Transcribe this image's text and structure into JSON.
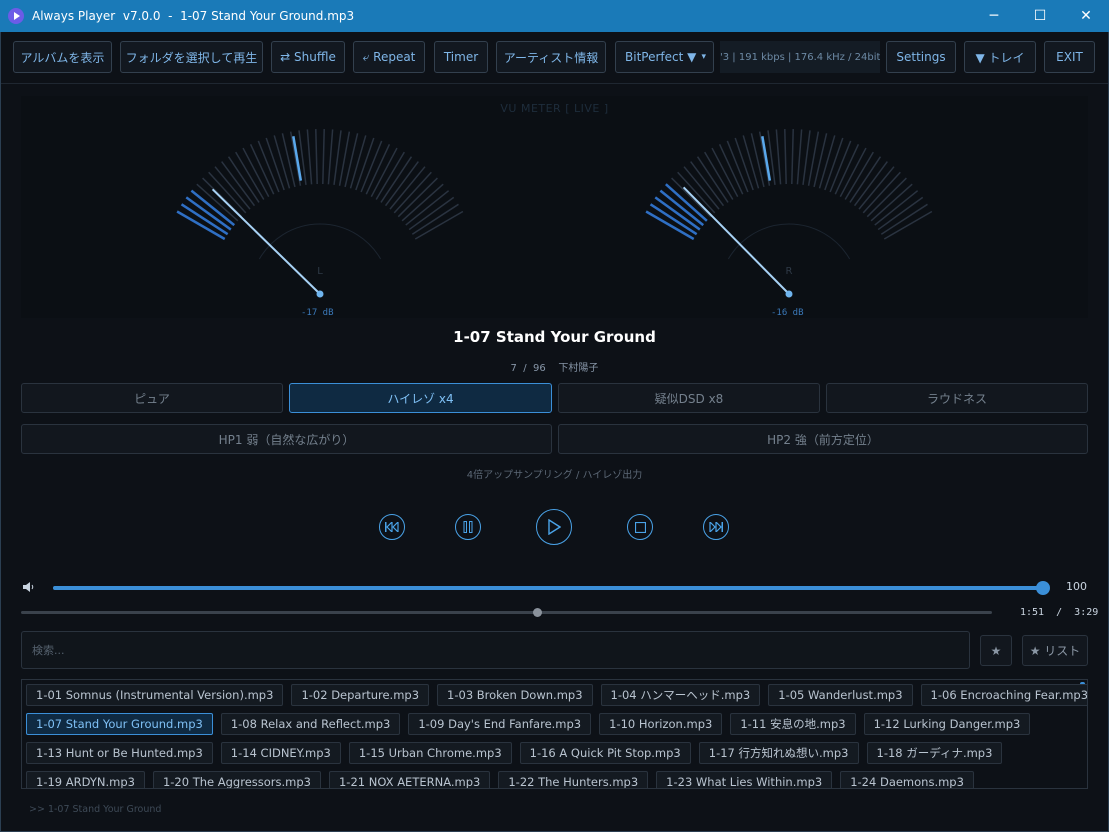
{
  "window": {
    "title": "Always Player  v7.0.0  -  1-07 Stand Your Ground.mp3",
    "minimize": "─",
    "maximize": "☐",
    "close": "✕"
  },
  "toolbar": {
    "album": "アルバムを表示",
    "folder_play": "フォルダを選択して再生",
    "shuffle": "⇄ Shuffle",
    "repeat": "⤶ Repeat",
    "timer": "Timer",
    "artist_info": "アーティスト情報",
    "bitperfect": "BitPerfect ▼",
    "bitperfect_arrow": "▾",
    "format_info": "'3 | 191 kbps | 176.4 kHz / 24bit",
    "settings": "Settings",
    "tray": "▼ トレイ",
    "exit": "EXIT"
  },
  "vu_meter": {
    "title": "VU METER  [ LIVE ]",
    "left": {
      "channel": "L",
      "db_readout": "-17 dB",
      "level_db": -17
    },
    "right": {
      "channel": "R",
      "db_readout": "-16 dB",
      "level_db": -16
    }
  },
  "now_playing": {
    "title": "1-07 Stand Your Ground",
    "subtitle": "7  /  96    下村陽子"
  },
  "dsp_modes": {
    "pure": "ピュア",
    "hires": "ハイレゾ x4",
    "dsd": "疑似DSD x8",
    "loudness": "ラウドネス",
    "hp1": "HP1  弱（自然な広がり）",
    "hp2": "HP2  強（前方定位）",
    "active": "hires",
    "description": "4倍アップサンプリング / ハイレゾ出力"
  },
  "volume": {
    "value": "100",
    "fraction": 1.0
  },
  "progress": {
    "time": "1:51  /  3:29",
    "fraction": 0.531
  },
  "search": {
    "placeholder": "検索...",
    "favorite": "★",
    "favorite_list": "★ リスト"
  },
  "playlist": {
    "rows": [
      [
        "1-01 Somnus (Instrumental Version).mp3",
        "1-02 Departure.mp3",
        "1-03 Broken Down.mp3",
        "1-04 ハンマーヘッド.mp3",
        "1-05 Wanderlust.mp3",
        "1-06 Encroaching Fear.mp3"
      ],
      [
        "1-07 Stand Your Ground.mp3",
        "1-08 Relax and Reflect.mp3",
        "1-09 Day's End Fanfare.mp3",
        "1-10 Horizon.mp3",
        "1-11 安息の地.mp3",
        "1-12 Lurking Danger.mp3"
      ],
      [
        "1-13 Hunt or Be Hunted.mp3",
        "1-14 CIDNEY.mp3",
        "1-15 Urban Chrome.mp3",
        "1-16 A Quick Pit Stop.mp3",
        "1-17 行方知れぬ想い.mp3",
        "1-18 ガーディナ.mp3"
      ],
      [
        "1-19 ARDYN.mp3",
        "1-20 The Aggressors.mp3",
        "1-21 NOX AETERNA.mp3",
        "1-22 The Hunters.mp3",
        "1-23 What Lies Within.mp3",
        "1-24 Daemons.mp3"
      ]
    ],
    "active": "1-07 Stand Your Ground.mp3"
  },
  "status": {
    "text": ">> 1-07 Stand Your Ground"
  },
  "colors": {
    "accent": "#4aa3e8",
    "titlebar": "#1a7ab8",
    "background": "#0d1117"
  }
}
